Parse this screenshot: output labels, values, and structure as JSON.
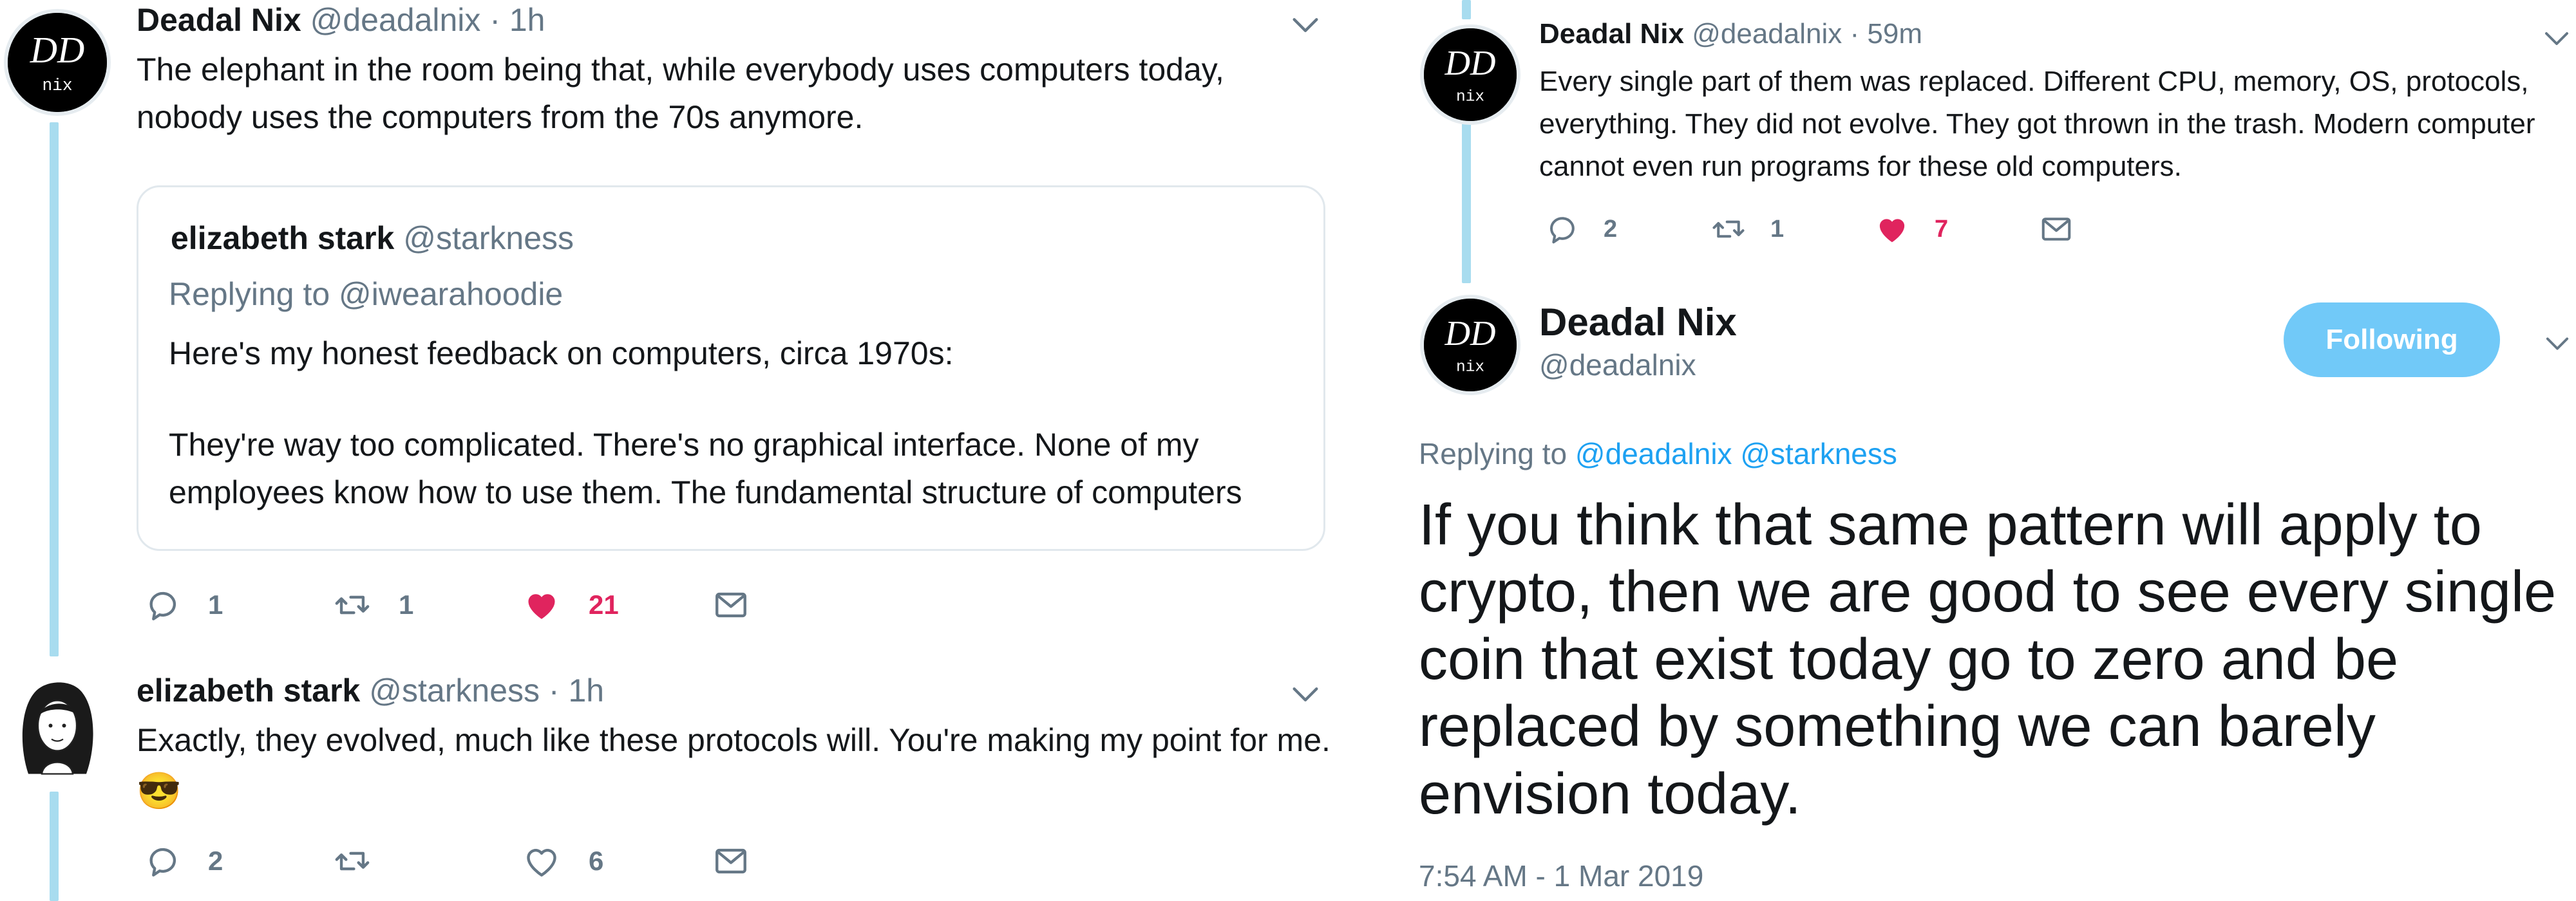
{
  "left": {
    "tweet1": {
      "name": "Deadal Nix",
      "handle": "@deadalnix",
      "time": "· 1h",
      "text": "The elephant in the room being that, while everybody uses computers today, nobody uses the computers from the 70s anymore.",
      "quote": {
        "name": "elizabeth stark",
        "handle": "@starkness",
        "replying": "Replying to @iwearahoodie",
        "line1": "Here's my honest feedback on computers, circa 1970s:",
        "line2": "They're way too complicated. There's no graphical interface. None of my employees know how to use them. The fundamental structure of computers"
      },
      "actions": {
        "replies": "1",
        "retweets": "1",
        "likes": "21"
      }
    },
    "tweet2": {
      "name": "elizabeth stark",
      "handle": "@starkness",
      "time": "· 1h",
      "text": "Exactly, they evolved, much like these protocols will. You're making my point for me.",
      "emoji": "😎",
      "actions": {
        "replies": "2",
        "retweets": "",
        "likes": "6"
      }
    }
  },
  "right": {
    "tweet3": {
      "name": "Deadal Nix",
      "handle": "@deadalnix",
      "time": "· 59m",
      "text": "Every single part of them was replaced. Different CPU, memory, OS, protocols, everything. They did not evolve. They got thrown in the trash. Modern computer cannot even run programs for these old computers.",
      "actions": {
        "replies": "2",
        "retweets": "1",
        "likes": "7"
      }
    },
    "main": {
      "name": "Deadal Nix",
      "handle": "@deadalnix",
      "follow_label": "Following",
      "replying_prefix": "Replying to",
      "mention1": "@deadalnix",
      "mention2": "@starkness",
      "text": "If you think that same pattern will apply to crypto, then we are good to see every single coin that exist today go to zero and be replaced by something we can barely envision today.",
      "timestamp": "7:54 AM - 1 Mar 2019"
    }
  },
  "avatar_text": {
    "monogram": "DD",
    "sub": "nix"
  },
  "colors": {
    "accent": "#1da1f2",
    "like": "#e0245e",
    "muted": "#657786",
    "thread": "#a8dcef",
    "follow": "#71c9f8"
  },
  "icons": [
    "reply-icon",
    "retweet-icon",
    "heart-icon",
    "mail-icon",
    "chevron-down-icon"
  ]
}
